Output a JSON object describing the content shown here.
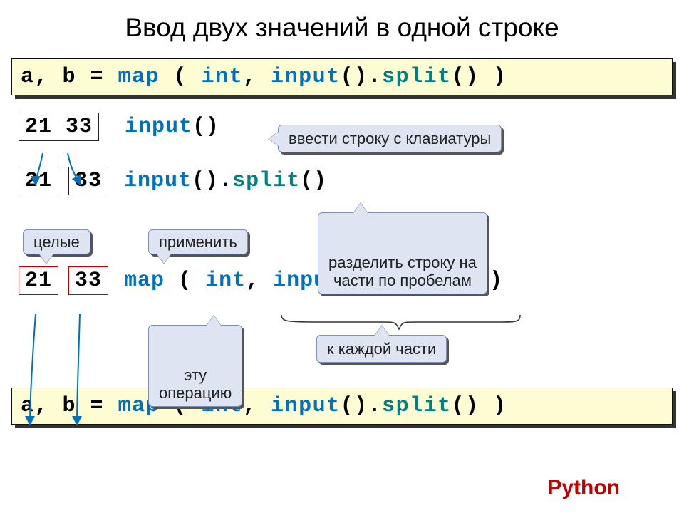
{
  "title": "Ввод двух значений в одной строке",
  "code": {
    "lhs": "a, b = ",
    "map": "map",
    "open_sp": " ( ",
    "int": "int",
    "comma_sp": ", ",
    "input": "input",
    "parens": "()",
    "dot": ".",
    "split": "split",
    "close_sp": " )"
  },
  "vals": {
    "v21": "21",
    "v33": "33",
    "pair": "21 33"
  },
  "steps": {
    "s1": {
      "box": "pair",
      "expr": "input()"
    },
    "s2": {
      "expr": "input().split()"
    },
    "s3": {
      "expr": "map ( int, input().split() )"
    }
  },
  "callouts": {
    "c1": "ввести строку с клавиатуры",
    "c2": "разделить строку на\nчасти по пробелам",
    "c3": "целые",
    "c4": "применить",
    "c5": "эту\nоперацию",
    "c6": "к каждой части"
  },
  "footer": "Python"
}
